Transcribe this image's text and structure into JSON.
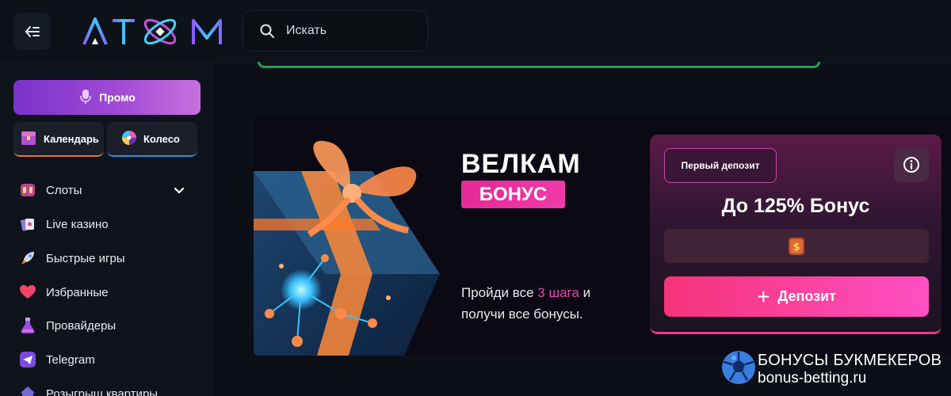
{
  "header": {
    "search_placeholder": "Искать"
  },
  "sidebar": {
    "promo_label": "Промо",
    "calendar_label": "Календарь",
    "wheel_label": "Колесо",
    "items": [
      {
        "label": "Слоты"
      },
      {
        "label": "Live казино"
      },
      {
        "label": "Быстрые игры"
      },
      {
        "label": "Избранные"
      },
      {
        "label": "Провайдеры"
      },
      {
        "label": "Telegram"
      },
      {
        "label": "Розыгрыш квартиры"
      }
    ]
  },
  "banner": {
    "title": "ВЕЛКАМ",
    "tag": "БОНУС",
    "desc_pre": "Пройди все ",
    "desc_highlight": "3 шага",
    "desc_post": " и получи все бонусы."
  },
  "card": {
    "chip": "Первый депозит",
    "title": "До 125% Бонус",
    "deposit_label": "Депозит"
  },
  "watermark": {
    "line1": "БОНУСЫ БУКМЕКЕРОВ",
    "line2": "bonus-betting.ru"
  },
  "colors": {
    "accent_pink": "#e62a98",
    "promo_purple": "#a04ad6",
    "card_bg": "#5b1b48",
    "green_accent": "#1f9f58"
  }
}
